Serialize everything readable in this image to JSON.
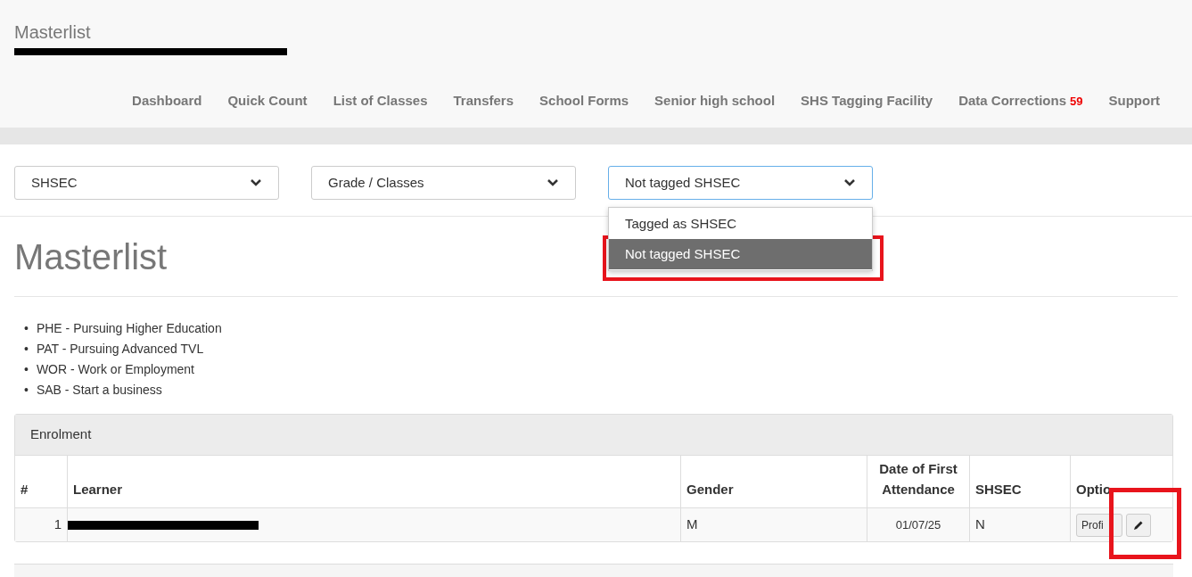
{
  "header": {
    "title": "Masterlist"
  },
  "nav": [
    {
      "label": "Dashboard"
    },
    {
      "label": "Quick Count"
    },
    {
      "label": "List of Classes"
    },
    {
      "label": "Transfers"
    },
    {
      "label": "School Forms"
    },
    {
      "label": "Senior high school"
    },
    {
      "label": "SHS Tagging Facility"
    },
    {
      "label": "Data Corrections",
      "badge": "59"
    },
    {
      "label": "Support"
    }
  ],
  "filters": [
    {
      "value": "SHSEC",
      "focused": false
    },
    {
      "value": "Grade / Classes",
      "focused": false
    },
    {
      "value": "Not tagged SHSEC",
      "focused": true,
      "options": [
        {
          "label": "Tagged as SHSEC",
          "selected": false
        },
        {
          "label": "Not tagged SHSEC",
          "selected": true
        }
      ]
    }
  ],
  "heading": "Masterlist",
  "legend": [
    {
      "marker": "•",
      "text": "PHE - Pursuing Higher Education"
    },
    {
      "marker": "•",
      "text": "PAT - Pursuing Advanced TVL"
    },
    {
      "marker": "•",
      "text": "WOR - Work or Employment"
    },
    {
      "marker": "•",
      "text": "SAB - Start a business"
    }
  ],
  "panel": {
    "title": "Enrolment",
    "columns": [
      "#",
      "Learner",
      "Gender",
      "Date of First Attendance",
      "SHSEC",
      "Optio"
    ],
    "rows": [
      {
        "number": "1",
        "gender": "M",
        "date": "01/07/25",
        "shsec": "N",
        "profile_button": "Profi"
      }
    ]
  }
}
